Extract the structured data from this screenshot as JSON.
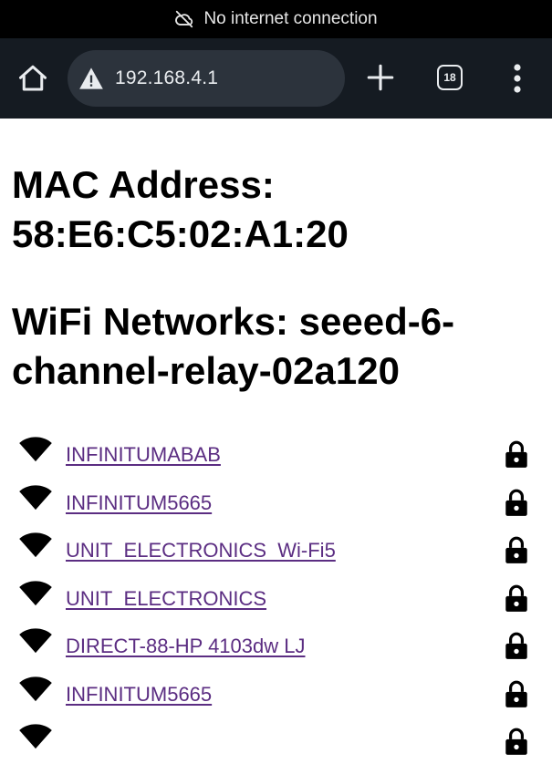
{
  "status_bar": {
    "icon": "cloud-off-icon",
    "text": "No internet connection"
  },
  "toolbar": {
    "url": "192.168.4.1",
    "tab_count": "18",
    "icons": [
      "home-icon",
      "warning-icon",
      "plus-icon",
      "tabs-icon",
      "more-vert-icon"
    ],
    "background": "#151b22",
    "omnibox_background": "#2c333c"
  },
  "page": {
    "mac_heading": "MAC Address: 58:E6:C5:02:A1:20",
    "wifi_heading": "WiFi Networks: seeed-6-channel-relay-02a120",
    "link_color": "#5b2d82",
    "networks": [
      {
        "ssid": "INFINITUMABAB",
        "icon": "wifi-icon",
        "secured": "lock-icon"
      },
      {
        "ssid": "INFINITUM5665",
        "icon": "wifi-icon",
        "secured": "lock-icon"
      },
      {
        "ssid": "UNIT_ELECTRONICS_Wi-Fi5",
        "icon": "wifi-icon",
        "secured": "lock-icon"
      },
      {
        "ssid": "UNIT_ELECTRONICS",
        "icon": "wifi-icon",
        "secured": "lock-icon"
      },
      {
        "ssid": "DIRECT-88-HP 4103dw LJ",
        "icon": "wifi-icon",
        "secured": "lock-icon"
      },
      {
        "ssid": "INFINITUM5665",
        "icon": "wifi-icon",
        "secured": "lock-icon"
      }
    ]
  }
}
